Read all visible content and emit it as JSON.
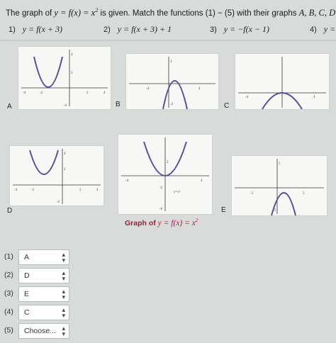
{
  "question": {
    "prefix": "The graph of",
    "given_expr": "y = f(x) = x",
    "given_exp": "2",
    "suffix": "is given.  Match the functions (1) − (5)  with their graphs",
    "labels_expr": "A, B, C, D"
  },
  "functions": [
    {
      "num": "1)",
      "expr": "y = f(x + 3)"
    },
    {
      "num": "2)",
      "expr": "y = f(x + 3) + 1"
    },
    {
      "num": "3)",
      "expr": "y = −f(x − 1)"
    },
    {
      "num": "4)",
      "expr": "y ="
    }
  ],
  "graphs": [
    {
      "label": "A",
      "ticks": [
        "-4",
        "-2",
        "2",
        "4",
        "4",
        "2",
        "-2"
      ],
      "function": "(x+3)^2"
    },
    {
      "label": "B",
      "ticks": [
        "-4",
        "4",
        "2",
        "-2"
      ],
      "function": "-(x-1)^2+?"
    },
    {
      "label": "C",
      "ticks": [
        "-4",
        "4"
      ],
      "function": "-(x)^2"
    },
    {
      "label": "D",
      "ticks": [
        "-4",
        "-2",
        "2",
        "4",
        "4",
        "2",
        "-2"
      ],
      "function": "(x+3)^2+1"
    },
    {
      "label": "",
      "ticks": [
        "-4",
        "4",
        "2",
        "-2",
        "-6"
      ],
      "function": "x^2",
      "inner_label": "y=x²"
    },
    {
      "label": "E",
      "ticks": [
        "-5",
        "5",
        "5",
        "-5"
      ],
      "function": "-(x-1)^2"
    }
  ],
  "caption": {
    "text": "Graph of",
    "expr": "y = f(x) = x",
    "exp": "2"
  },
  "answers": [
    {
      "num": "(1)",
      "value": "A"
    },
    {
      "num": "(2)",
      "value": "D"
    },
    {
      "num": "(3)",
      "value": "E"
    },
    {
      "num": "(4)",
      "value": "C"
    },
    {
      "num": "(5)",
      "value": "Choose..."
    }
  ],
  "colors": {
    "curve": "#5b4f9a",
    "axis": "#333333",
    "caption": "#a61c3c"
  }
}
